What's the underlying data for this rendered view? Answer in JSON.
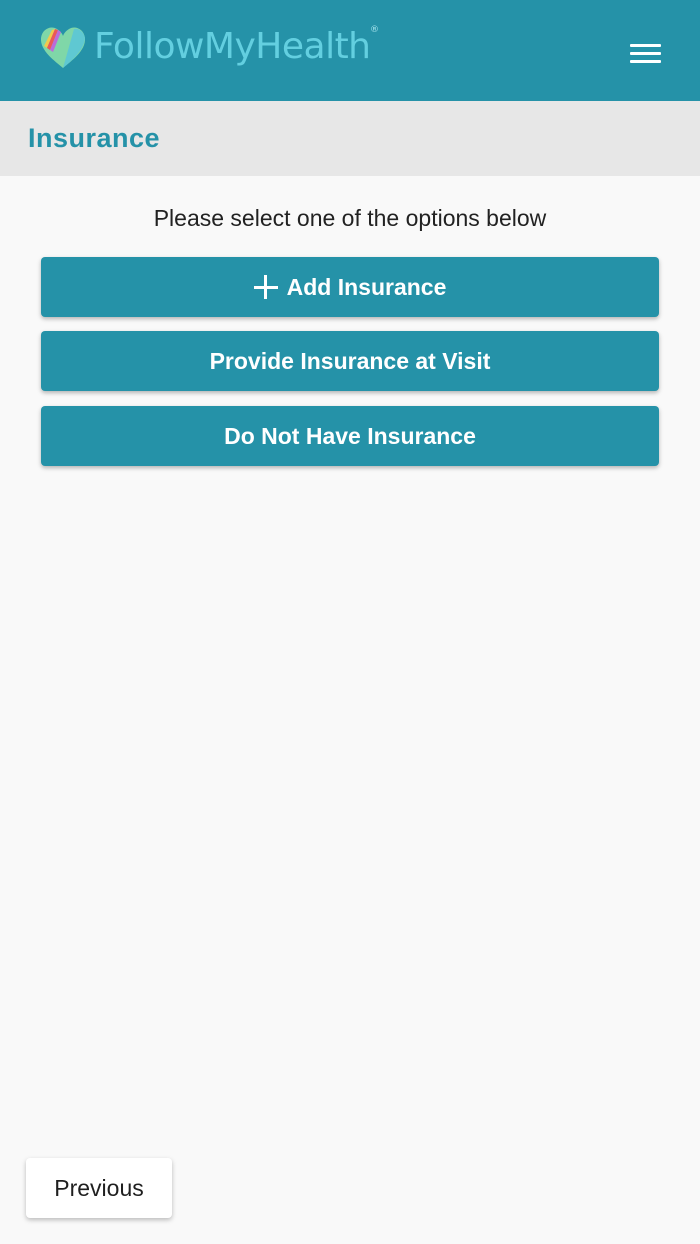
{
  "header": {
    "brand_name": "FollowMyHealth",
    "registered_mark": "®",
    "logo_icon": "heart-logo-icon",
    "menu_icon": "hamburger-menu-icon",
    "background_color": "#2592a8",
    "brand_text_color": "#63cfe0"
  },
  "title_bar": {
    "title": "Insurance",
    "background_color": "#e7e7e7",
    "title_color": "#2592a8"
  },
  "main": {
    "instruction": "Please select one of the options below",
    "options": [
      {
        "label": "Add Insurance",
        "icon": "plus-icon"
      },
      {
        "label": "Provide Insurance at Visit"
      },
      {
        "label": "Do Not Have Insurance"
      }
    ],
    "button_color": "#2592a8"
  },
  "footer": {
    "previous_label": "Previous"
  }
}
